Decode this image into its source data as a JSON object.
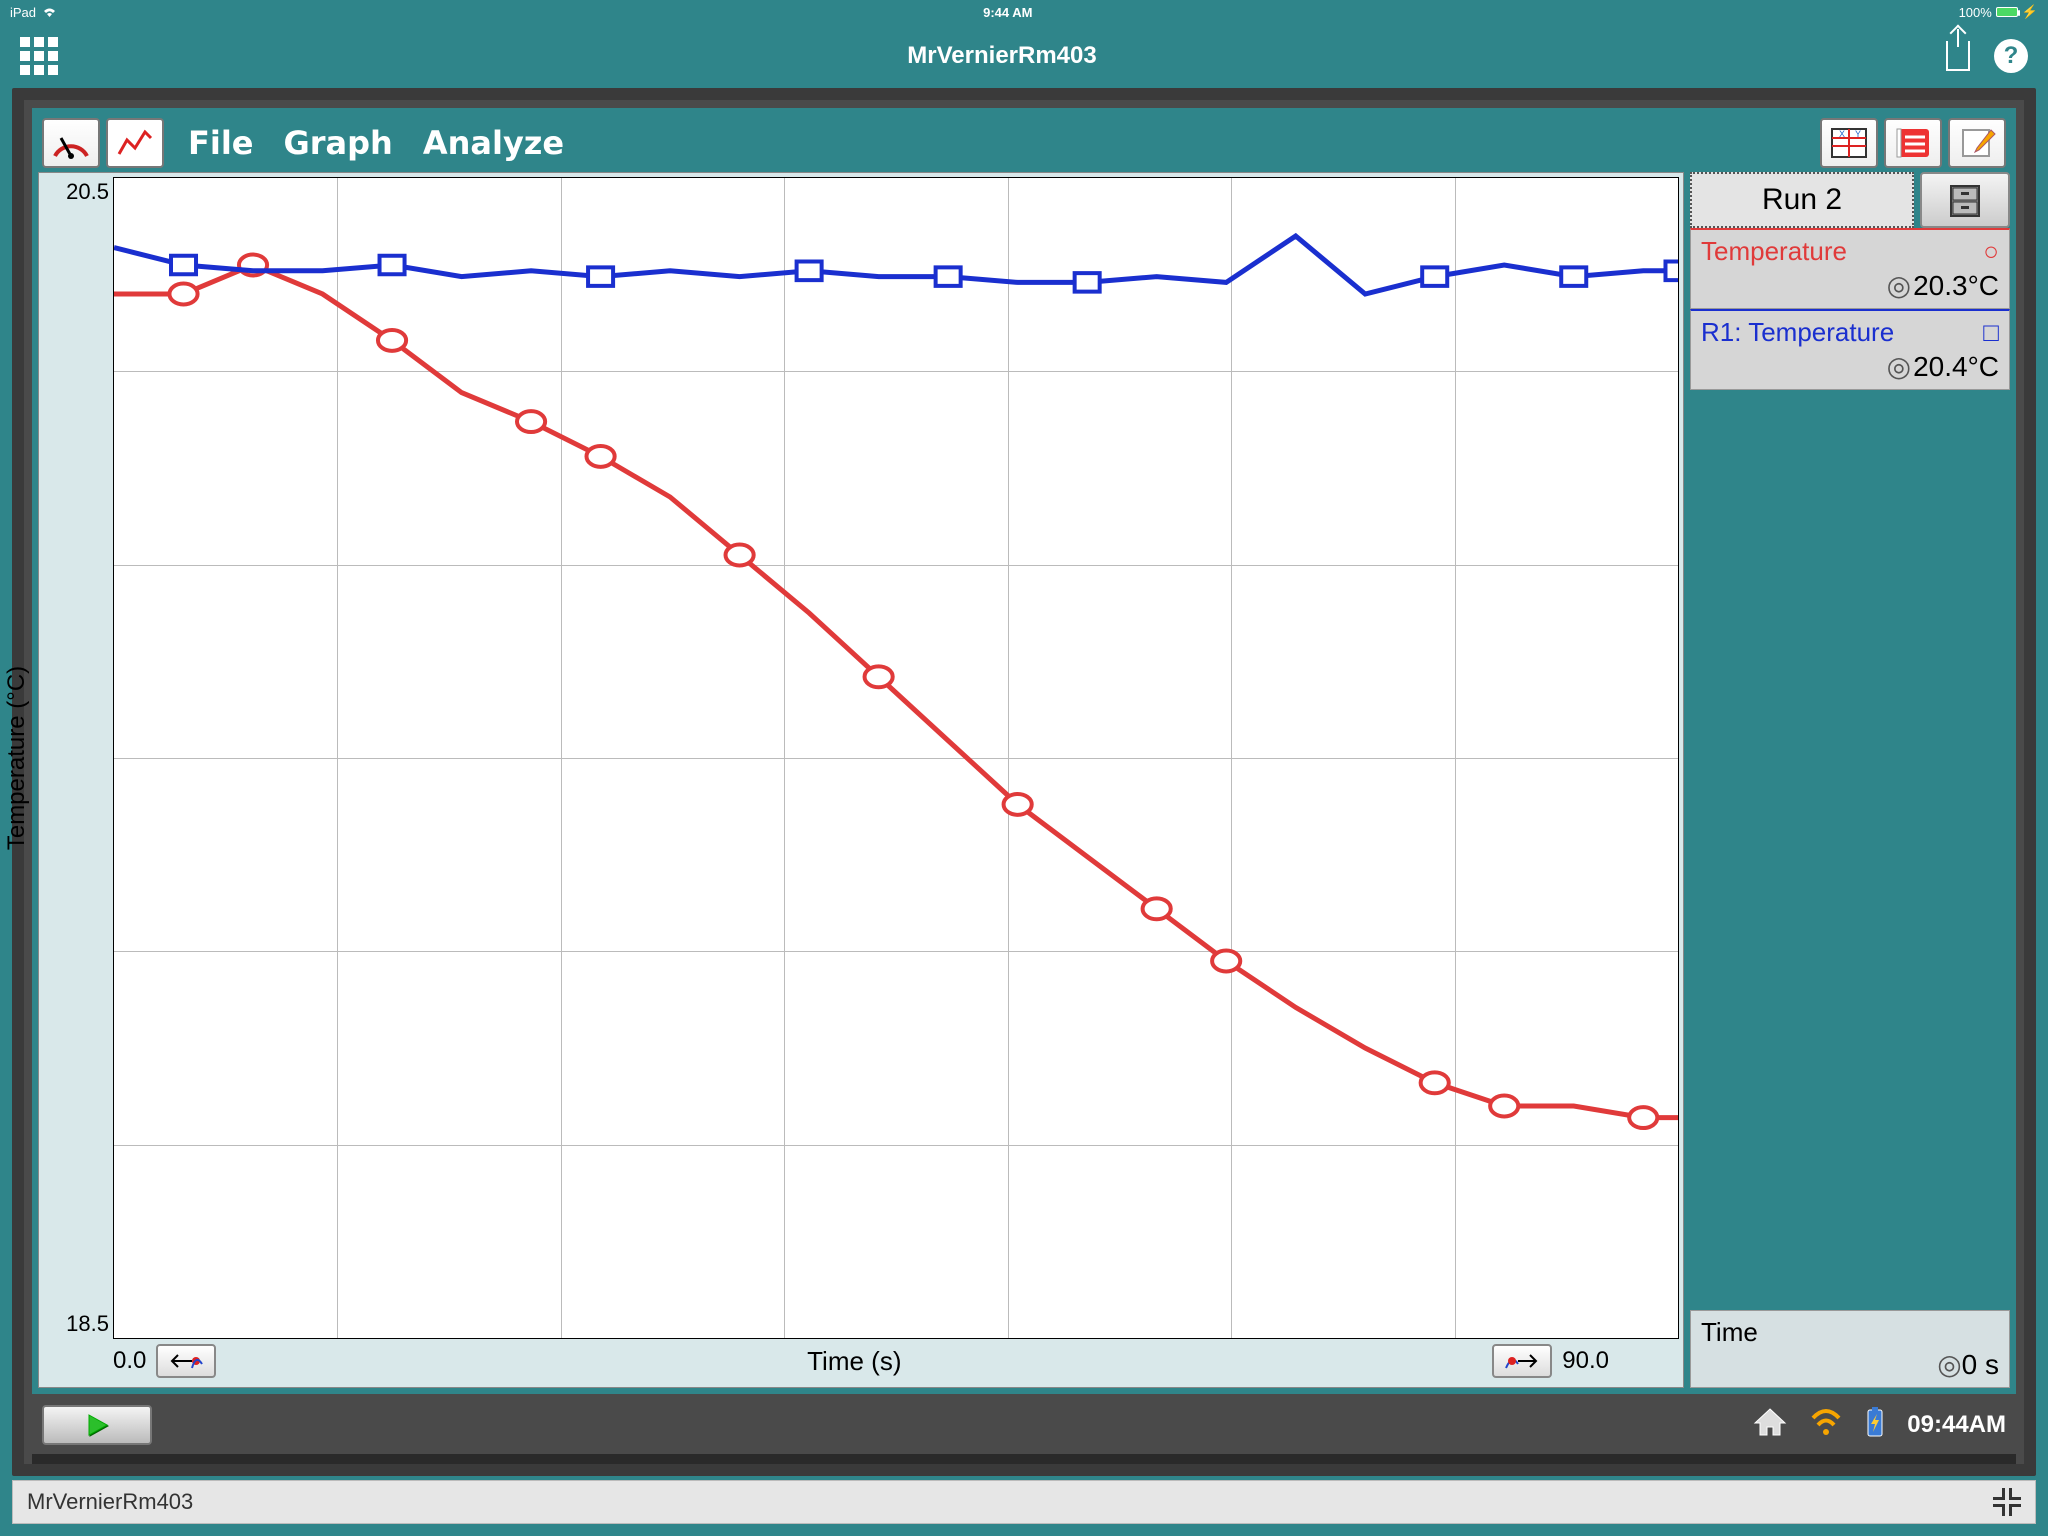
{
  "ios_status": {
    "device": "iPad",
    "time": "9:44 AM",
    "battery": "100%"
  },
  "app_bar": {
    "title": "MrVernierRm403"
  },
  "menu": {
    "items": [
      "File",
      "Graph",
      "Analyze"
    ]
  },
  "chart_data": {
    "type": "line",
    "xlabel": "Time (s)",
    "ylabel": "Temperature (°C)",
    "xlim": [
      0.0,
      90.0
    ],
    "ylim": [
      18.5,
      20.5
    ],
    "x": [
      0,
      4,
      8,
      12,
      16,
      20,
      24,
      28,
      32,
      36,
      40,
      44,
      48,
      52,
      56,
      60,
      64,
      68,
      72,
      76,
      80,
      84,
      88,
      90
    ],
    "series": [
      {
        "name": "Temperature",
        "color": "#e03a3a",
        "marker": "circle",
        "values": [
          20.3,
          20.3,
          20.35,
          20.3,
          20.22,
          20.13,
          20.08,
          20.02,
          19.95,
          19.85,
          19.75,
          19.64,
          19.53,
          19.42,
          19.33,
          19.24,
          19.15,
          19.07,
          19.0,
          18.94,
          18.9,
          18.9,
          18.88,
          18.88
        ],
        "marker_x": [
          3,
          9,
          18,
          24,
          30,
          38,
          46,
          54,
          60,
          66,
          76,
          82,
          88
        ]
      },
      {
        "name": "R1: Temperature",
        "color": "#1a2fcf",
        "marker": "square",
        "values": [
          20.38,
          20.35,
          20.34,
          20.34,
          20.35,
          20.33,
          20.34,
          20.33,
          20.34,
          20.33,
          20.34,
          20.33,
          20.33,
          20.32,
          20.32,
          20.33,
          20.32,
          20.4,
          20.3,
          20.33,
          20.35,
          20.33,
          20.34,
          20.34
        ],
        "marker_x": [
          3,
          15,
          28,
          40,
          48,
          56,
          76,
          84,
          90
        ]
      }
    ],
    "y_ticks": [
      "20.5",
      "18.5"
    ],
    "x_ticks": [
      "0.0",
      "90.0"
    ]
  },
  "sidebar": {
    "run_label": "Run 2",
    "sensors": [
      {
        "name": "Temperature",
        "value": "20.3°C",
        "color": "#e03a3a",
        "marker": "○"
      },
      {
        "name": "R1: Temperature",
        "value": "20.4°C",
        "color": "#1a2fcf",
        "marker": "□"
      }
    ],
    "time": {
      "label": "Time",
      "value": "0 s"
    }
  },
  "bottom": {
    "clock": "09:44AM"
  },
  "footer": {
    "label": "MrVernierRm403"
  }
}
